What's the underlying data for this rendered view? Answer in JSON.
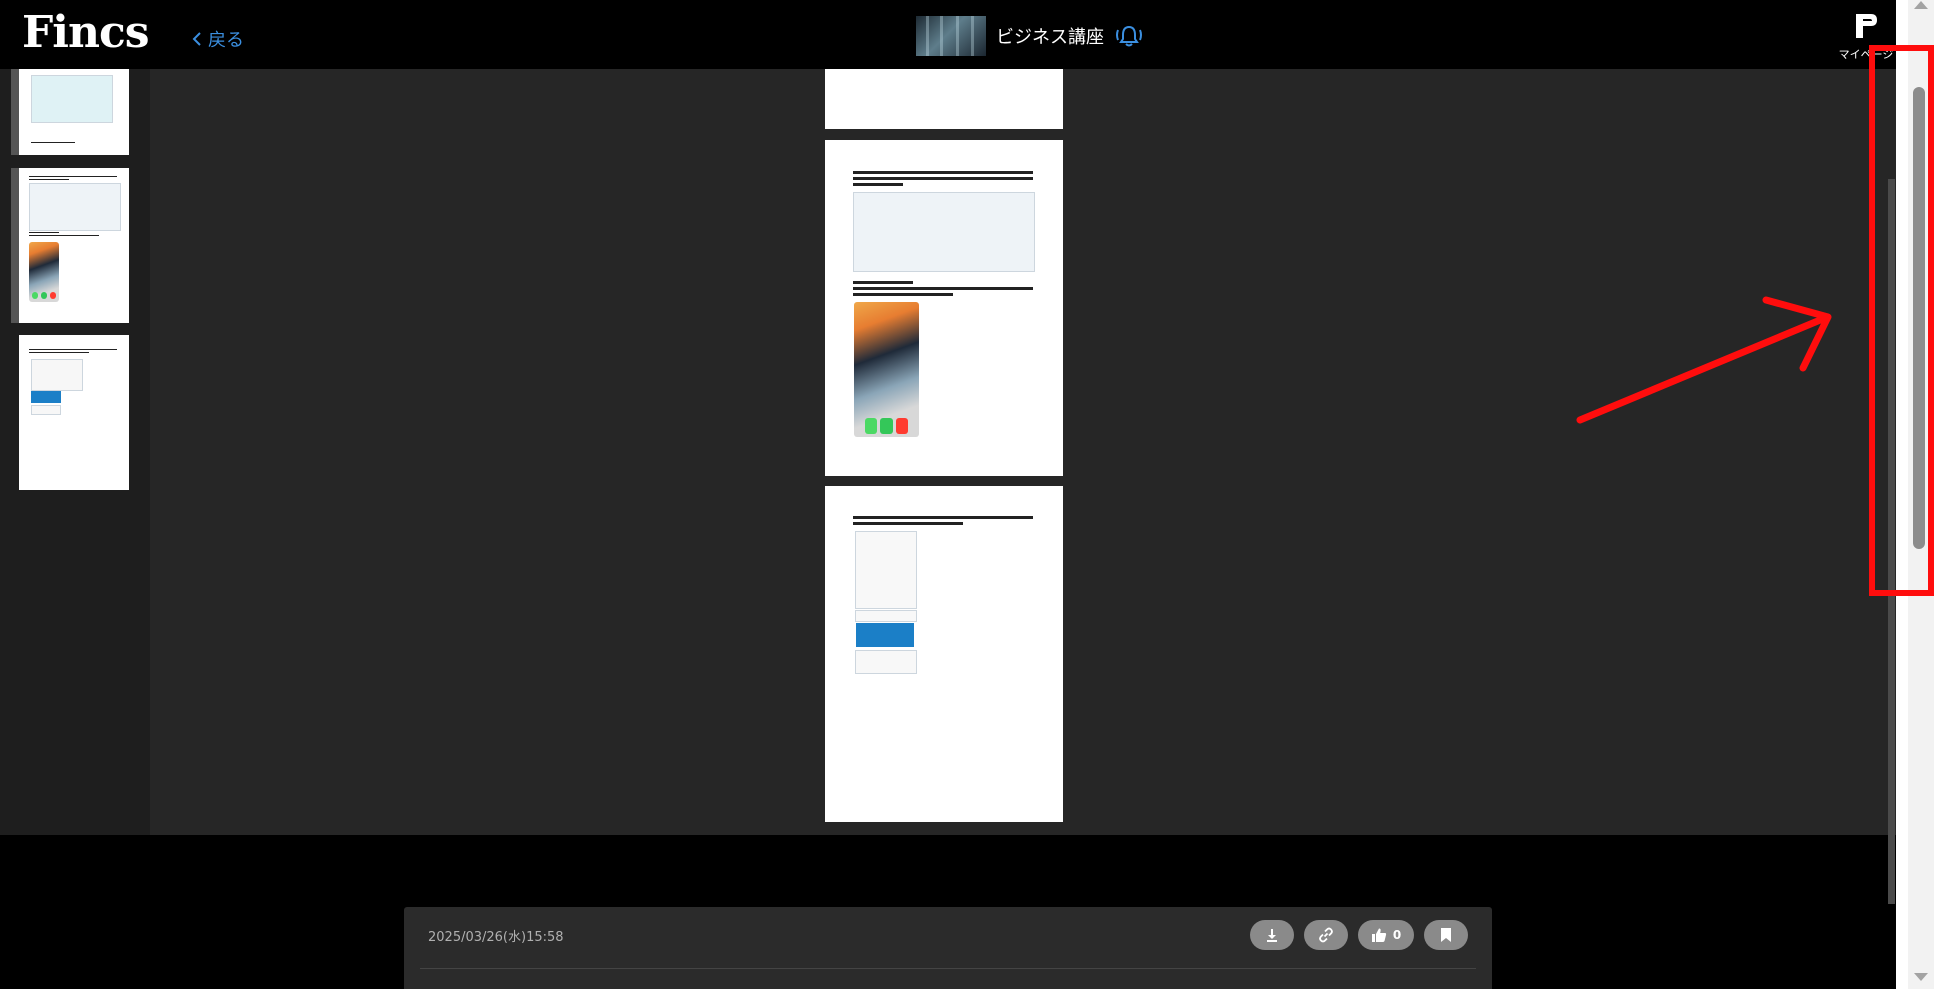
{
  "header": {
    "logo": "Fincs",
    "back_label": "戻る",
    "course_title": "ビジネス講座",
    "mypage_label": "マイページ"
  },
  "post": {
    "date": "2025/03/26(水)15:58",
    "like_count": "0"
  },
  "colors": {
    "accent": "#3b8fe0",
    "annotation": "#ff0d0d"
  },
  "icons": {
    "back": "chevron-left-icon",
    "notify": "bell-ringing-icon",
    "download": "download-icon",
    "link": "link-icon",
    "like": "thumbs-up-icon",
    "bookmark": "bookmark-icon"
  }
}
